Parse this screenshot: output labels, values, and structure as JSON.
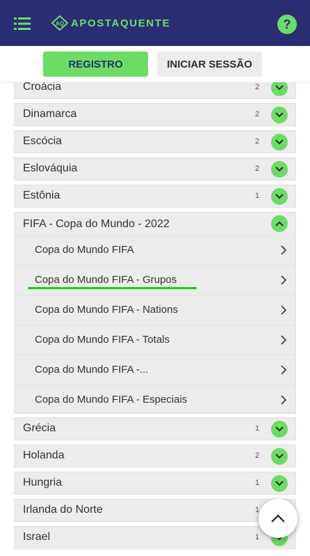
{
  "header": {
    "menu_icon": "hamburger-menu-icon",
    "logo_mark": "AQ",
    "logo_text": "APOSTAQUENTE",
    "help_label": "?",
    "colors": {
      "header_bg": "#2b2d72",
      "accent_green": "#6bdc66"
    }
  },
  "auth": {
    "register_label": "REGISTRO",
    "login_label": "INICIAR SESSÃO"
  },
  "countries_before": [
    {
      "label": "Croácia",
      "count": "2"
    },
    {
      "label": "Dinamarca",
      "count": "2"
    },
    {
      "label": "Escócia",
      "count": "2"
    },
    {
      "label": "Eslováquia",
      "count": "2"
    },
    {
      "label": "Estônia",
      "count": "1"
    }
  ],
  "expanded": {
    "label": "FIFA - Copa do Mundo - 2022",
    "items": [
      {
        "label": "Copa do Mundo FIFA"
      },
      {
        "label": "Copa do Mundo FIFA - Grupos"
      },
      {
        "label": "Copa do Mundo FIFA - Nations"
      },
      {
        "label": "Copa do Mundo FIFA - Totals"
      },
      {
        "label": "Copa do Mundo FIFA -..."
      },
      {
        "label": "Copa do Mundo FIFA - Especiais"
      }
    ]
  },
  "countries_after": [
    {
      "label": "Grécia",
      "count": "1"
    },
    {
      "label": "Holanda",
      "count": "2"
    },
    {
      "label": "Hungria",
      "count": "1"
    },
    {
      "label": "Irlanda do Norte",
      "count": "1"
    },
    {
      "label": "Israel",
      "count": "1"
    }
  ]
}
